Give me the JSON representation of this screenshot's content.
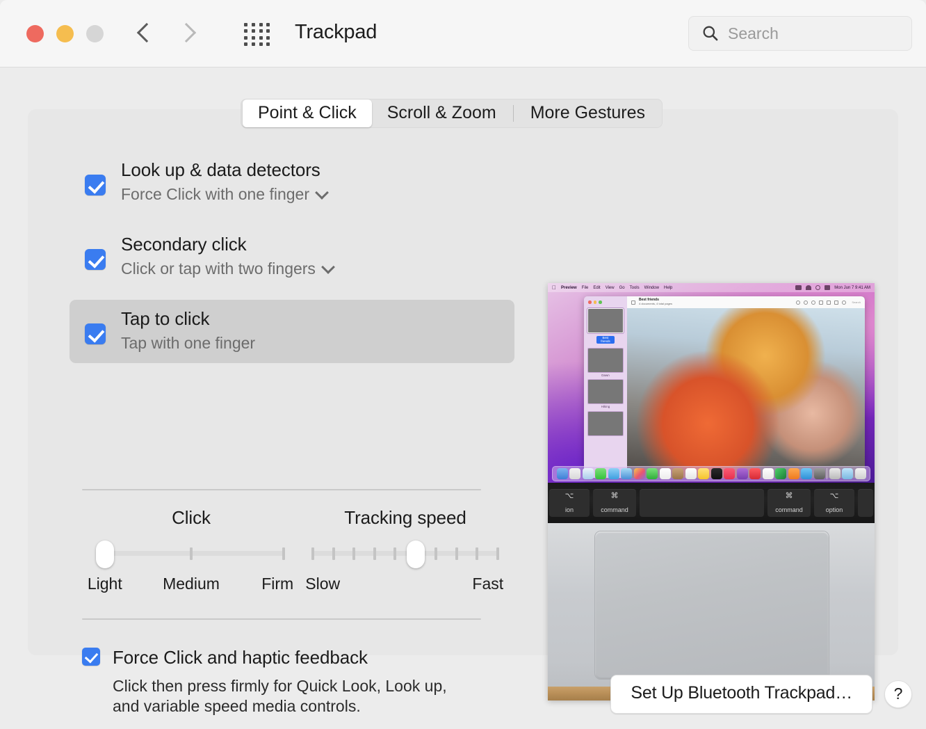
{
  "window": {
    "title": "Trackpad",
    "traffic_lights": [
      "close",
      "minimize",
      "zoom"
    ],
    "nav": {
      "back": "back-arrow",
      "forward": "forward-arrow",
      "grid": "show-all-grid"
    }
  },
  "search": {
    "placeholder": "Search",
    "value": "",
    "icon": "search-icon"
  },
  "tabs": [
    {
      "label": "Point & Click",
      "active": true
    },
    {
      "label": "Scroll & Zoom",
      "active": false
    },
    {
      "label": "More Gestures",
      "active": false
    }
  ],
  "options": [
    {
      "title": "Look up & data detectors",
      "subtitle": "Force Click with one finger",
      "has_dropdown": true,
      "checked": true,
      "selected": false
    },
    {
      "title": "Secondary click",
      "subtitle": "Click or tap with two fingers",
      "has_dropdown": true,
      "checked": true,
      "selected": false
    },
    {
      "title": "Tap to click",
      "subtitle": "Tap with one finger",
      "has_dropdown": false,
      "checked": true,
      "selected": true
    }
  ],
  "sliders": {
    "click": {
      "label": "Click",
      "ticks": 3,
      "value_index": 0,
      "tick_labels": [
        "Light",
        "Medium",
        "Firm"
      ]
    },
    "tracking": {
      "label": "Tracking speed",
      "ticks": 10,
      "value_index": 5,
      "min_label": "Slow",
      "max_label": "Fast"
    }
  },
  "force_click": {
    "checked": true,
    "title": "Force Click and haptic feedback",
    "description_line1": "Click then press firmly for Quick Look, Look up,",
    "description_line2": "and variable speed media controls."
  },
  "bottom": {
    "setup_button": "Set Up Bluetooth Trackpad…",
    "help_button": "?"
  },
  "preview": {
    "menubar": {
      "apple": "",
      "items": [
        "Preview",
        "File",
        "Edit",
        "View",
        "Go",
        "Tools",
        "Window",
        "Help"
      ],
      "clock": "Mon Jun 7 9:41 AM"
    },
    "app": {
      "doc_title": "Best friends",
      "doc_subtitle": "4 documents, 4 total pages",
      "search_placeholder": "Search",
      "thumbnails": [
        {
          "caption": "Best friends",
          "selected": true
        },
        {
          "caption": "Dawn",
          "selected": false
        },
        {
          "caption": "Hiking",
          "selected": false
        },
        {
          "caption": "",
          "selected": false
        }
      ]
    },
    "keyboard": {
      "keys": [
        {
          "glyph": "⌥",
          "label": "ion"
        },
        {
          "glyph": "⌘",
          "label": "command"
        },
        {
          "glyph": "",
          "label": ""
        },
        {
          "glyph": "⌘",
          "label": "command"
        },
        {
          "glyph": "⌥",
          "label": "option"
        }
      ]
    }
  },
  "colors": {
    "accent": "#3a7cf0",
    "window_bg": "#ececec",
    "panel_bg": "#e7e7e7",
    "titlebar_bg": "#f6f6f6",
    "selected_row": "#cfcfcf"
  }
}
